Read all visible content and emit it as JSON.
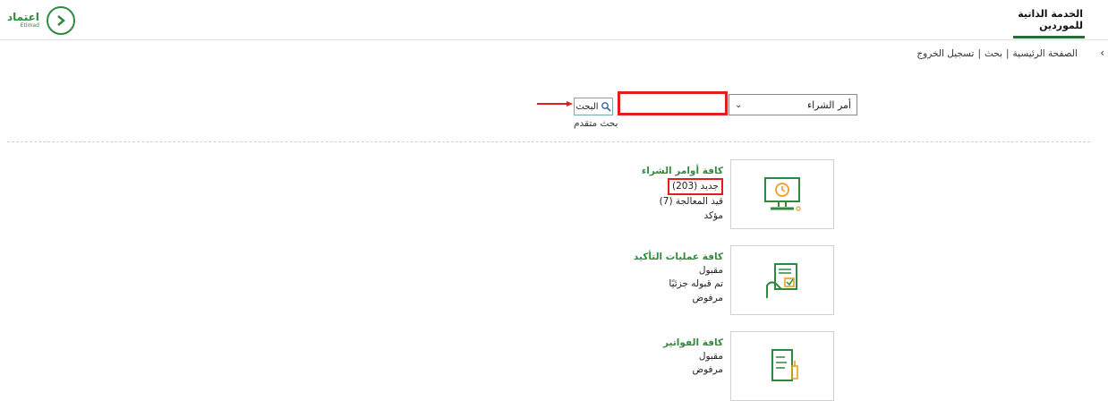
{
  "header": {
    "logo_ar": "اعتماد",
    "logo_en": "Etimad",
    "title_line1": "الخدمة الذاتية",
    "title_line2": "للموردين"
  },
  "breadcrumb": {
    "home": "الصفحة الرئيسية",
    "sep": "|",
    "search": "بحث",
    "logout": "تسجيل الخروج"
  },
  "search": {
    "doc_type_selected": "أمر الشراء",
    "input_value": "",
    "button_label": "البحث",
    "advanced_label": "بحث متقدم"
  },
  "sections": [
    {
      "title": "كافة أوامر الشراء",
      "items": [
        "جديد (203)",
        "قيد المعالجة (7)",
        "مؤكد"
      ]
    },
    {
      "title": "كافة عمليات التأكيد",
      "items": [
        "مقبول",
        "تم قبوله جزئيًا",
        "مرفوض"
      ]
    },
    {
      "title": "كافة الفواتير",
      "items": [
        "مقبول",
        "مرفوض"
      ]
    }
  ],
  "colors": {
    "brand_green": "#2e8b3d",
    "highlight_red": "#e11d1d"
  },
  "icons": {
    "tile1": "monitor-clock-icon",
    "tile2": "hand-document-icon",
    "tile3": "invoice-pen-icon"
  }
}
